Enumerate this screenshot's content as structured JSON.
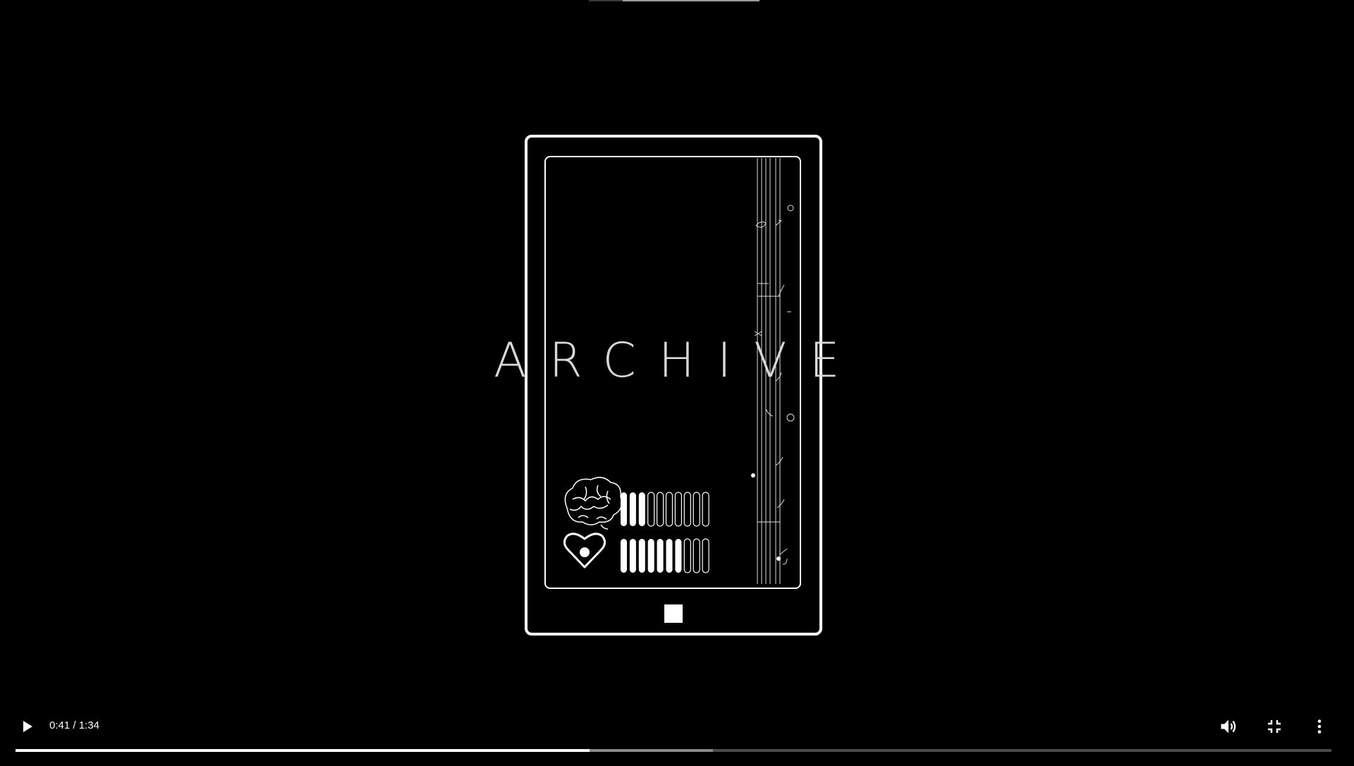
{
  "video": {
    "title_overlay": "ARCHIVE"
  },
  "player": {
    "current_time": "0:41",
    "separator": "/",
    "duration": "1:34",
    "progress_fraction": 0.436,
    "buffered_fraction": 0.53,
    "icons": {
      "play": "play-icon",
      "volume": "volume-high-icon",
      "exit_fullscreen": "exit-fullscreen-icon",
      "more": "more-vertical-icon"
    }
  },
  "meters": {
    "brain_level": 3,
    "brain_total": 10,
    "heart_level": 7,
    "heart_total": 10
  },
  "colors": {
    "background": "#000000",
    "line_art": "#ffffff",
    "progress_played": "#ffffff",
    "progress_buffered": "#8a8a8a",
    "progress_track": "#4a4a4a"
  }
}
